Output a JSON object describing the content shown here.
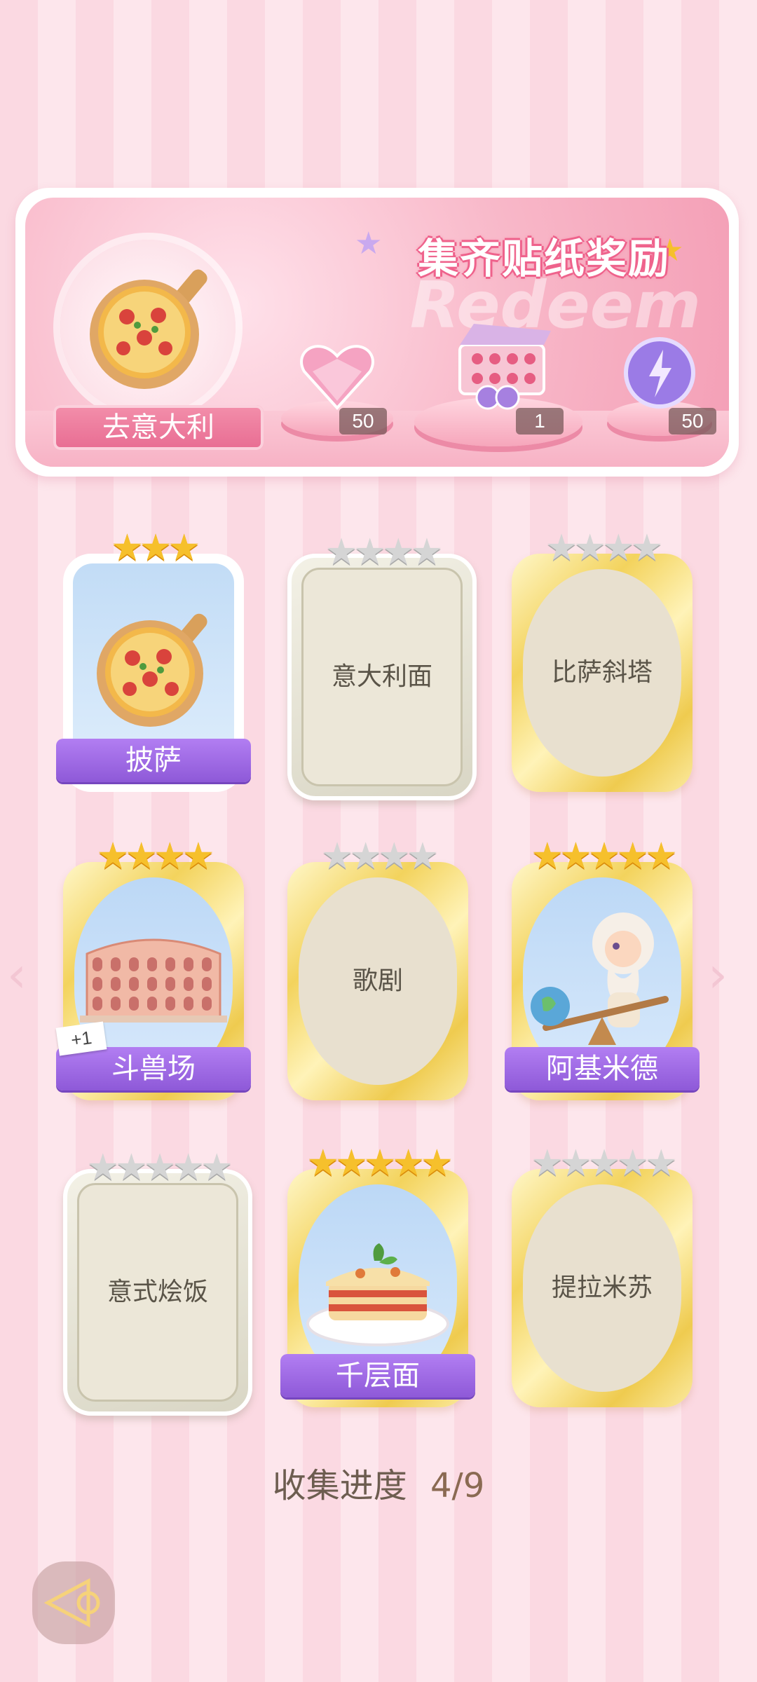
{
  "banner": {
    "title": "集齐贴纸奖励",
    "watermark": "Redeem",
    "theme_label": "去意大利",
    "rewards": [
      {
        "icon": "heart-gem-icon",
        "count": "50"
      },
      {
        "icon": "gift-box-icon",
        "count": "1"
      },
      {
        "icon": "energy-orb-icon",
        "count": "50"
      }
    ]
  },
  "cards": [
    {
      "name": "披萨",
      "stars_on": 3,
      "stars_total": 3,
      "collected": true,
      "style": "plain",
      "icon": "pizza-icon"
    },
    {
      "name": "意大利面",
      "stars_on": 0,
      "stars_total": 4,
      "collected": false,
      "style": "silver"
    },
    {
      "name": "比萨斜塔",
      "stars_on": 0,
      "stars_total": 4,
      "collected": false,
      "style": "gold"
    },
    {
      "name": "斗兽场",
      "stars_on": 4,
      "stars_total": 4,
      "collected": true,
      "style": "gold",
      "icon": "colosseum-icon",
      "tag": "+1"
    },
    {
      "name": "歌剧",
      "stars_on": 0,
      "stars_total": 4,
      "collected": false,
      "style": "gold"
    },
    {
      "name": "阿基米德",
      "stars_on": 5,
      "stars_total": 5,
      "collected": true,
      "style": "gold",
      "icon": "archimedes-icon"
    },
    {
      "name": "意式烩饭",
      "stars_on": 0,
      "stars_total": 5,
      "collected": false,
      "style": "silver"
    },
    {
      "name": "千层面",
      "stars_on": 5,
      "stars_total": 5,
      "collected": true,
      "style": "gold",
      "icon": "lasagna-icon"
    },
    {
      "name": "提拉米苏",
      "stars_on": 0,
      "stars_total": 5,
      "collected": false,
      "style": "gold"
    }
  ],
  "progress": {
    "label": "收集进度",
    "value": "4/9"
  },
  "colors": {
    "accent_purple": "#9b66e0",
    "star_gold": "#f6c02c",
    "banner_pink": "#f49fb6"
  }
}
